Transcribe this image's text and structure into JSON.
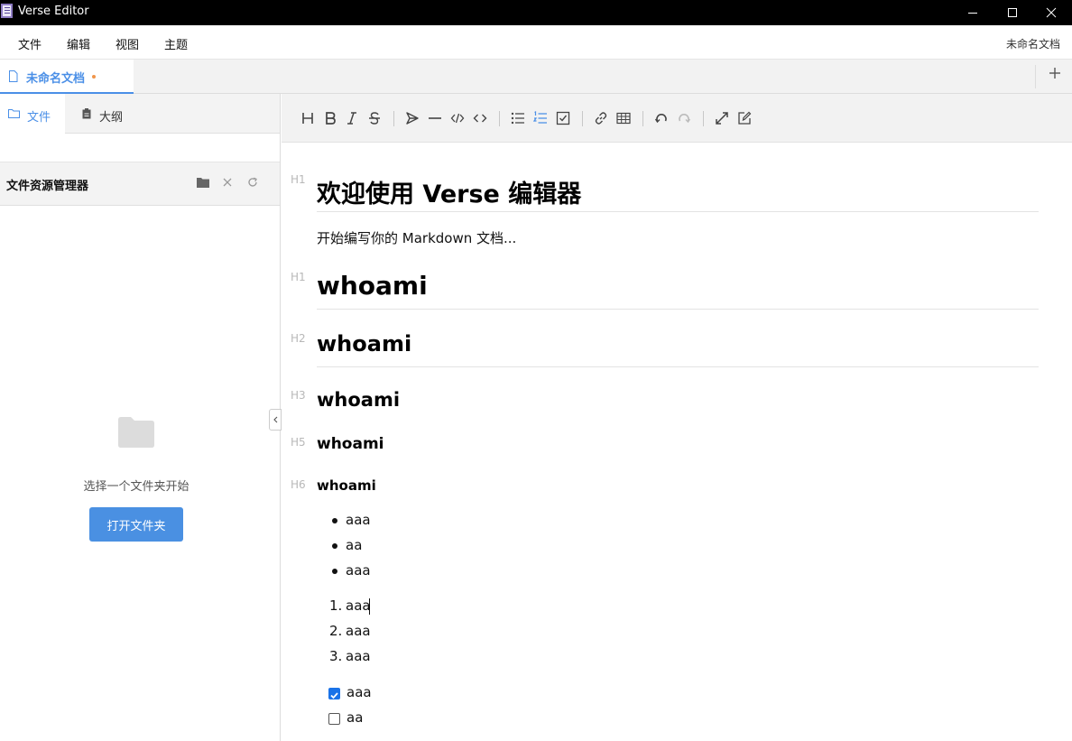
{
  "window": {
    "title": "Verse Editor",
    "controls": [
      "minimize-icon",
      "maximize-icon",
      "close-icon"
    ]
  },
  "menubar": {
    "items": [
      "文件",
      "编辑",
      "视图",
      "主题"
    ],
    "document_name": "未命名文档"
  },
  "tabs": {
    "active_tab": {
      "label": "未命名文档",
      "unsaved": true
    },
    "add_icon": "plus-icon"
  },
  "sidebar": {
    "tabs": [
      {
        "label": "文件",
        "icon": "file-icon",
        "active": true
      },
      {
        "label": "大纲",
        "icon": "clipboard-icon",
        "active": false
      }
    ],
    "explorer": {
      "title": "文件资源管理器",
      "actions": [
        "folder-icon",
        "close-icon",
        "refresh-icon"
      ],
      "empty_text": "选择一个文件夹开始",
      "open_button": "打开文件夹"
    }
  },
  "toolbar": {
    "groups": [
      [
        "heading-icon",
        "bold-icon",
        "italic-icon",
        "strikethrough-icon"
      ],
      [
        "quote-icon",
        "horizontal-rule-icon",
        "code-icon",
        "inline-code-icon"
      ],
      [
        "bullet-list-icon",
        "ordered-list-icon",
        "checkbox-icon"
      ],
      [
        "link-icon",
        "table-icon"
      ],
      [
        "undo-icon",
        "redo-icon"
      ],
      [
        "fullscreen-icon",
        "edit-icon"
      ]
    ]
  },
  "editor": {
    "blocks": {
      "h1_title": {
        "marker": "H1",
        "text": "欢迎使用 Verse 编辑器"
      },
      "intro": "开始编写你的 Markdown 文档...",
      "h1": {
        "marker": "H1",
        "text": "whoami"
      },
      "h2": {
        "marker": "H2",
        "text": "whoami"
      },
      "h3": {
        "marker": "H3",
        "text": "whoami"
      },
      "h5": {
        "marker": "H5",
        "text": "whoami"
      },
      "h6": {
        "marker": "H6",
        "text": "whoami"
      },
      "bullet_list": [
        "aaa",
        "aa",
        "aaa"
      ],
      "ordered_list": [
        {
          "num": "1.",
          "text": "aaa"
        },
        {
          "num": "2.",
          "text": "aaa"
        },
        {
          "num": "3.",
          "text": "aaa"
        }
      ],
      "task_list": [
        {
          "text": "aaa",
          "checked": true
        },
        {
          "text": "aa",
          "checked": false
        }
      ]
    }
  },
  "colors": {
    "accent": "#4a8fe7",
    "button": "#4a90e2",
    "unsaved_dot": "#f0954a",
    "checkbox": "#1a73e8"
  }
}
